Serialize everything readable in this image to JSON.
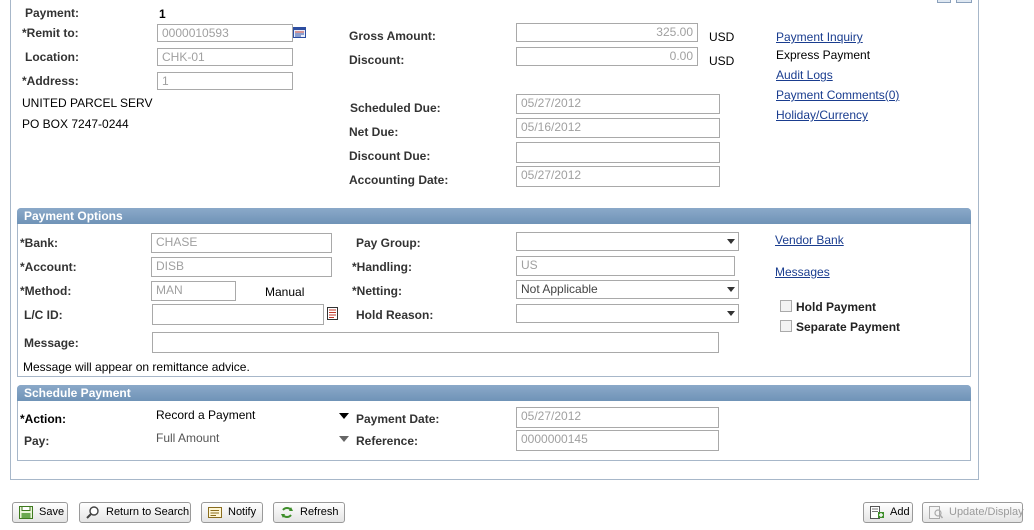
{
  "payment": {
    "payment_label": "Payment:",
    "payment_value": "1",
    "remit_to_label": "*Remit to:",
    "remit_to_value": "0000010593",
    "location_label": "Location:",
    "location_value": "CHK-01",
    "address_label": "*Address:",
    "address_value": "1",
    "address_line1": "UNITED PARCEL SERV",
    "address_line2": "PO BOX 7247-0244",
    "gross_amount_label": "Gross Amount:",
    "gross_amount_value": "325.00",
    "gross_currency": "USD",
    "discount_label": "Discount:",
    "discount_value": "0.00",
    "discount_currency": "USD",
    "scheduled_due_label": "Scheduled Due:",
    "scheduled_due_value": "05/27/2012",
    "net_due_label": "Net Due:",
    "net_due_value": "05/16/2012",
    "discount_due_label": "Discount Due:",
    "discount_due_value": "",
    "accounting_date_label": "Accounting Date:",
    "accounting_date_value": "05/27/2012"
  },
  "side_links": {
    "payment_inquiry": "Payment Inquiry",
    "express_payment": "Express Payment",
    "audit_logs": "Audit Logs",
    "payment_comments": "Payment Comments(0)",
    "holiday_currency": "Holiday/Currency"
  },
  "payment_options": {
    "title": "Payment Options",
    "bank_label": "*Bank:",
    "bank_value": "CHASE",
    "account_label": "*Account:",
    "account_value": "DISB",
    "method_label": "*Method:",
    "method_value": "MAN",
    "method_desc": "Manual",
    "lc_id_label": "L/C ID:",
    "lc_id_value": "",
    "message_label": "Message:",
    "message_value": "",
    "message_note": "Message will appear on remittance advice.",
    "pay_group_label": "Pay Group:",
    "pay_group_value": "",
    "handling_label": "*Handling:",
    "handling_value": "US",
    "netting_label": "*Netting:",
    "netting_value": "Not Applicable",
    "hold_reason_label": "Hold Reason:",
    "hold_reason_value": "",
    "vendor_bank_link": "Vendor Bank",
    "messages_link": "Messages",
    "hold_payment_label": "Hold Payment",
    "separate_payment_label": "Separate Payment"
  },
  "schedule_payment": {
    "title": "Schedule Payment",
    "action_label": "*Action:",
    "action_value": "Record a Payment",
    "pay_label": "Pay:",
    "pay_value": "Full Amount",
    "payment_date_label": "Payment Date:",
    "payment_date_value": "05/27/2012",
    "reference_label": "Reference:",
    "reference_value": "0000000145"
  },
  "toolbar": {
    "save": "Save",
    "return_to_search": "Return to Search",
    "notify": "Notify",
    "refresh": "Refresh",
    "add": "Add",
    "update_display": "Update/Display"
  },
  "icons": {
    "lookup": "lookup-icon",
    "save": "save-icon",
    "search": "magnifier-icon",
    "notify": "notify-icon",
    "refresh": "refresh-icon",
    "add": "add-icon",
    "update": "update-display-icon"
  }
}
